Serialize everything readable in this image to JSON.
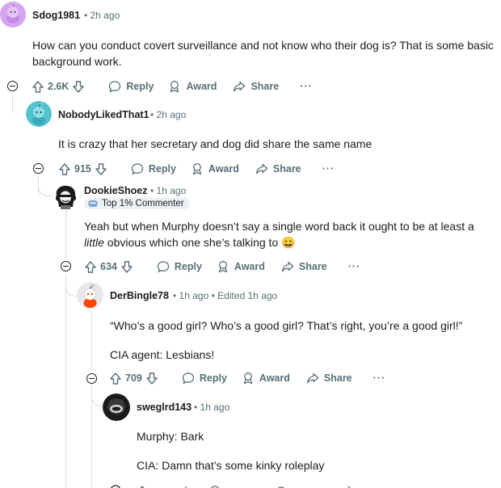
{
  "comments": [
    {
      "username": "Sdog1981",
      "time": "2h ago",
      "body_lines": [
        "How can you conduct covert surveillance and not know who their dog is? That is some basic",
        "background work."
      ],
      "votes": "2.6K",
      "reply": "Reply",
      "award": "Award",
      "share": "Share",
      "more": "···"
    },
    {
      "username": "NobodyLikedThat1",
      "time": "2h ago",
      "body_lines": [
        "It is crazy that her secretary and dog did share the same name"
      ],
      "votes": "915",
      "reply": "Reply",
      "award": "Award",
      "share": "Share",
      "more": "···"
    },
    {
      "username": "DookieShoez",
      "time": "1h ago",
      "flair": "Top 1% Commenter",
      "body_line1": "Yeah but when Murphy doesn’t say a single word back it ought to be at least a",
      "body_line2_em": "little",
      "body_line2_rest": " obvious which one she’s talking to",
      "emoji": "😄",
      "votes": "634",
      "reply": "Reply",
      "award": "Award",
      "share": "Share",
      "more": "···"
    },
    {
      "username": "DerBingle78",
      "time": "1h ago",
      "edited": "Edited 1h ago",
      "body_lines": [
        "“Who’s a good girl? Who’s a good girl? That’s right, you’re a good girl!”",
        "CIA agent: Lesbians!"
      ],
      "votes": "709",
      "reply": "Reply",
      "award": "Award",
      "share": "Share",
      "more": "···"
    },
    {
      "username": "sweglrd143",
      "time": "1h ago",
      "body_lines": [
        "Murphy: Bark",
        "CIA: Damn that’s some kinky roleplay"
      ]
    }
  ],
  "separator": "•",
  "colors": {
    "meta": "#576f76",
    "thread": "#d8dde0",
    "text": "#1c1c1c"
  }
}
